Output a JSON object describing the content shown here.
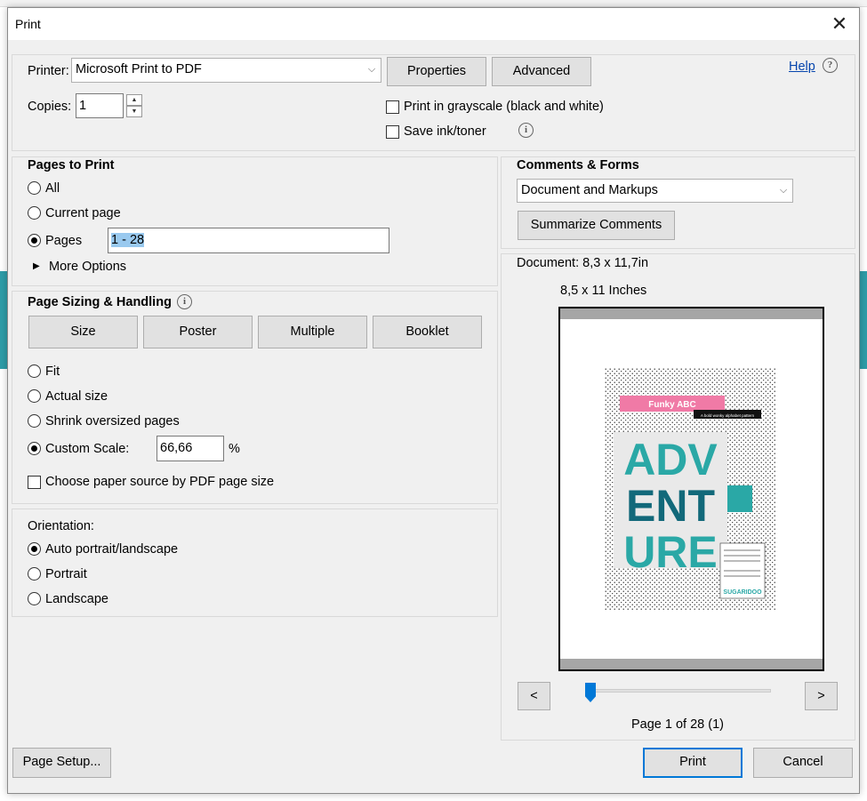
{
  "dialog": {
    "title": "Print",
    "close_glyph": "✕"
  },
  "printer": {
    "label": "Printer:",
    "selected": "Microsoft Print to PDF",
    "properties": "Properties",
    "advanced": "Advanced",
    "help": "Help"
  },
  "copies": {
    "label": "Copies:",
    "value": "1"
  },
  "options": {
    "grayscale": "Print in grayscale (black and white)",
    "save_ink": "Save ink/toner"
  },
  "pages": {
    "heading": "Pages to Print",
    "all": "All",
    "current": "Current page",
    "pages": "Pages",
    "range": "1 - 28",
    "more": "More Options",
    "selected": "pages"
  },
  "sizing": {
    "heading": "Page Sizing & Handling",
    "tabs": [
      "Size",
      "Poster",
      "Multiple",
      "Booklet"
    ],
    "fit": "Fit",
    "actual": "Actual size",
    "shrink": "Shrink oversized pages",
    "custom": "Custom Scale:",
    "scale": "66,66",
    "pct": "%",
    "paper_source": "Choose paper source by PDF page size"
  },
  "orientation": {
    "heading": "Orientation:",
    "auto": "Auto portrait/landscape",
    "portrait": "Portrait",
    "landscape": "Landscape"
  },
  "comments": {
    "heading": "Comments & Forms",
    "selected": "Document and Markups",
    "summarize": "Summarize Comments"
  },
  "preview": {
    "document": "Document: 8,3 x 11,7in",
    "paper": "8,5 x 11 Inches",
    "prev": "<",
    "next": ">",
    "page_info": "Page 1 of 28 (1)",
    "slider_fraction": 0.0
  },
  "artwork": {
    "banner": "Funky ABC",
    "tagline": "A bold wonky alphabet pattern",
    "row1": "ADV",
    "row2": "ENT",
    "row3": "URE",
    "brand": "SUGARIDOO",
    "accent": "#2aa8a6",
    "pink": "#f07aa6"
  },
  "footer": {
    "page_setup": "Page Setup...",
    "print": "Print",
    "cancel": "Cancel"
  }
}
